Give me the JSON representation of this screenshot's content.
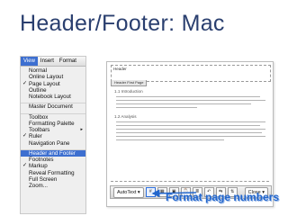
{
  "slide": {
    "title": "Header/Footer: Mac"
  },
  "menubar": {
    "items": [
      "View",
      "Insert",
      "Format"
    ],
    "active_index": 0
  },
  "view_menu": {
    "items": [
      {
        "label": "Normal",
        "checked": false
      },
      {
        "label": "Online Layout",
        "checked": false
      },
      {
        "label": "Page Layout",
        "checked": true
      },
      {
        "label": "Outline",
        "checked": false
      },
      {
        "label": "Notebook Layout",
        "checked": false
      },
      {
        "label": "Master Document",
        "checked": false,
        "separator_before": true
      },
      {
        "label": "Toolbox",
        "checked": false,
        "separator_before": true
      },
      {
        "label": "Formatting Palette",
        "checked": false
      },
      {
        "label": "Toolbars",
        "checked": false,
        "submenu": true
      },
      {
        "label": "Ruler",
        "checked": true
      },
      {
        "label": "Navigation Pane",
        "checked": false
      },
      {
        "label": "Header and Footer",
        "checked": false,
        "highlighted": true,
        "separator_before": true
      },
      {
        "label": "Footnotes",
        "checked": false
      },
      {
        "label": "Markup",
        "checked": true
      },
      {
        "label": "Reveal Formatting",
        "checked": false
      },
      {
        "label": "Full Screen",
        "checked": false
      },
      {
        "label": "Zoom...",
        "checked": false
      }
    ]
  },
  "document": {
    "header_label": "Header",
    "header_tab": "Header First Page",
    "section_1_1": "1.1 Introduction",
    "section_1_2": "1.2 Analysis"
  },
  "footer_toolbar": {
    "autotext": "AutoText ▾",
    "close": "Close ▾",
    "button_icons": [
      "#",
      "▦",
      "▣",
      "⌚",
      "≣",
      "↶",
      "⇆",
      "⇅"
    ],
    "highlighted_index": 0
  },
  "callout": {
    "text": "Format page numbers",
    "color": "#2266cc"
  }
}
